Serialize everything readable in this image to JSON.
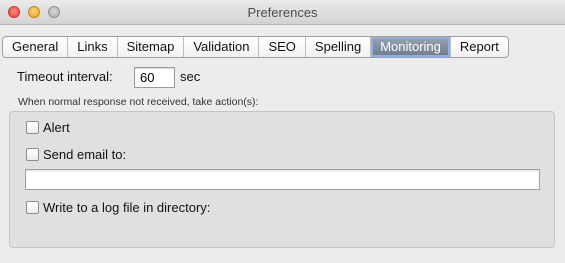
{
  "window": {
    "title": "Preferences"
  },
  "tabs": [
    {
      "label": "General"
    },
    {
      "label": "Links"
    },
    {
      "label": "Sitemap"
    },
    {
      "label": "Validation"
    },
    {
      "label": "SEO"
    },
    {
      "label": "Spelling"
    },
    {
      "label": "Monitoring",
      "selected": true
    },
    {
      "label": "Report"
    }
  ],
  "monitoring": {
    "timeout_label": "Timeout interval:",
    "timeout_value": "60",
    "timeout_unit": "sec",
    "action_caption": "When normal response not received, take action(s):",
    "options": {
      "alert": {
        "label": "Alert",
        "checked": false
      },
      "send_email": {
        "label": "Send email to:",
        "checked": false,
        "value": ""
      },
      "write_log": {
        "label": "Write to a log file in directory:",
        "checked": false
      }
    }
  }
}
